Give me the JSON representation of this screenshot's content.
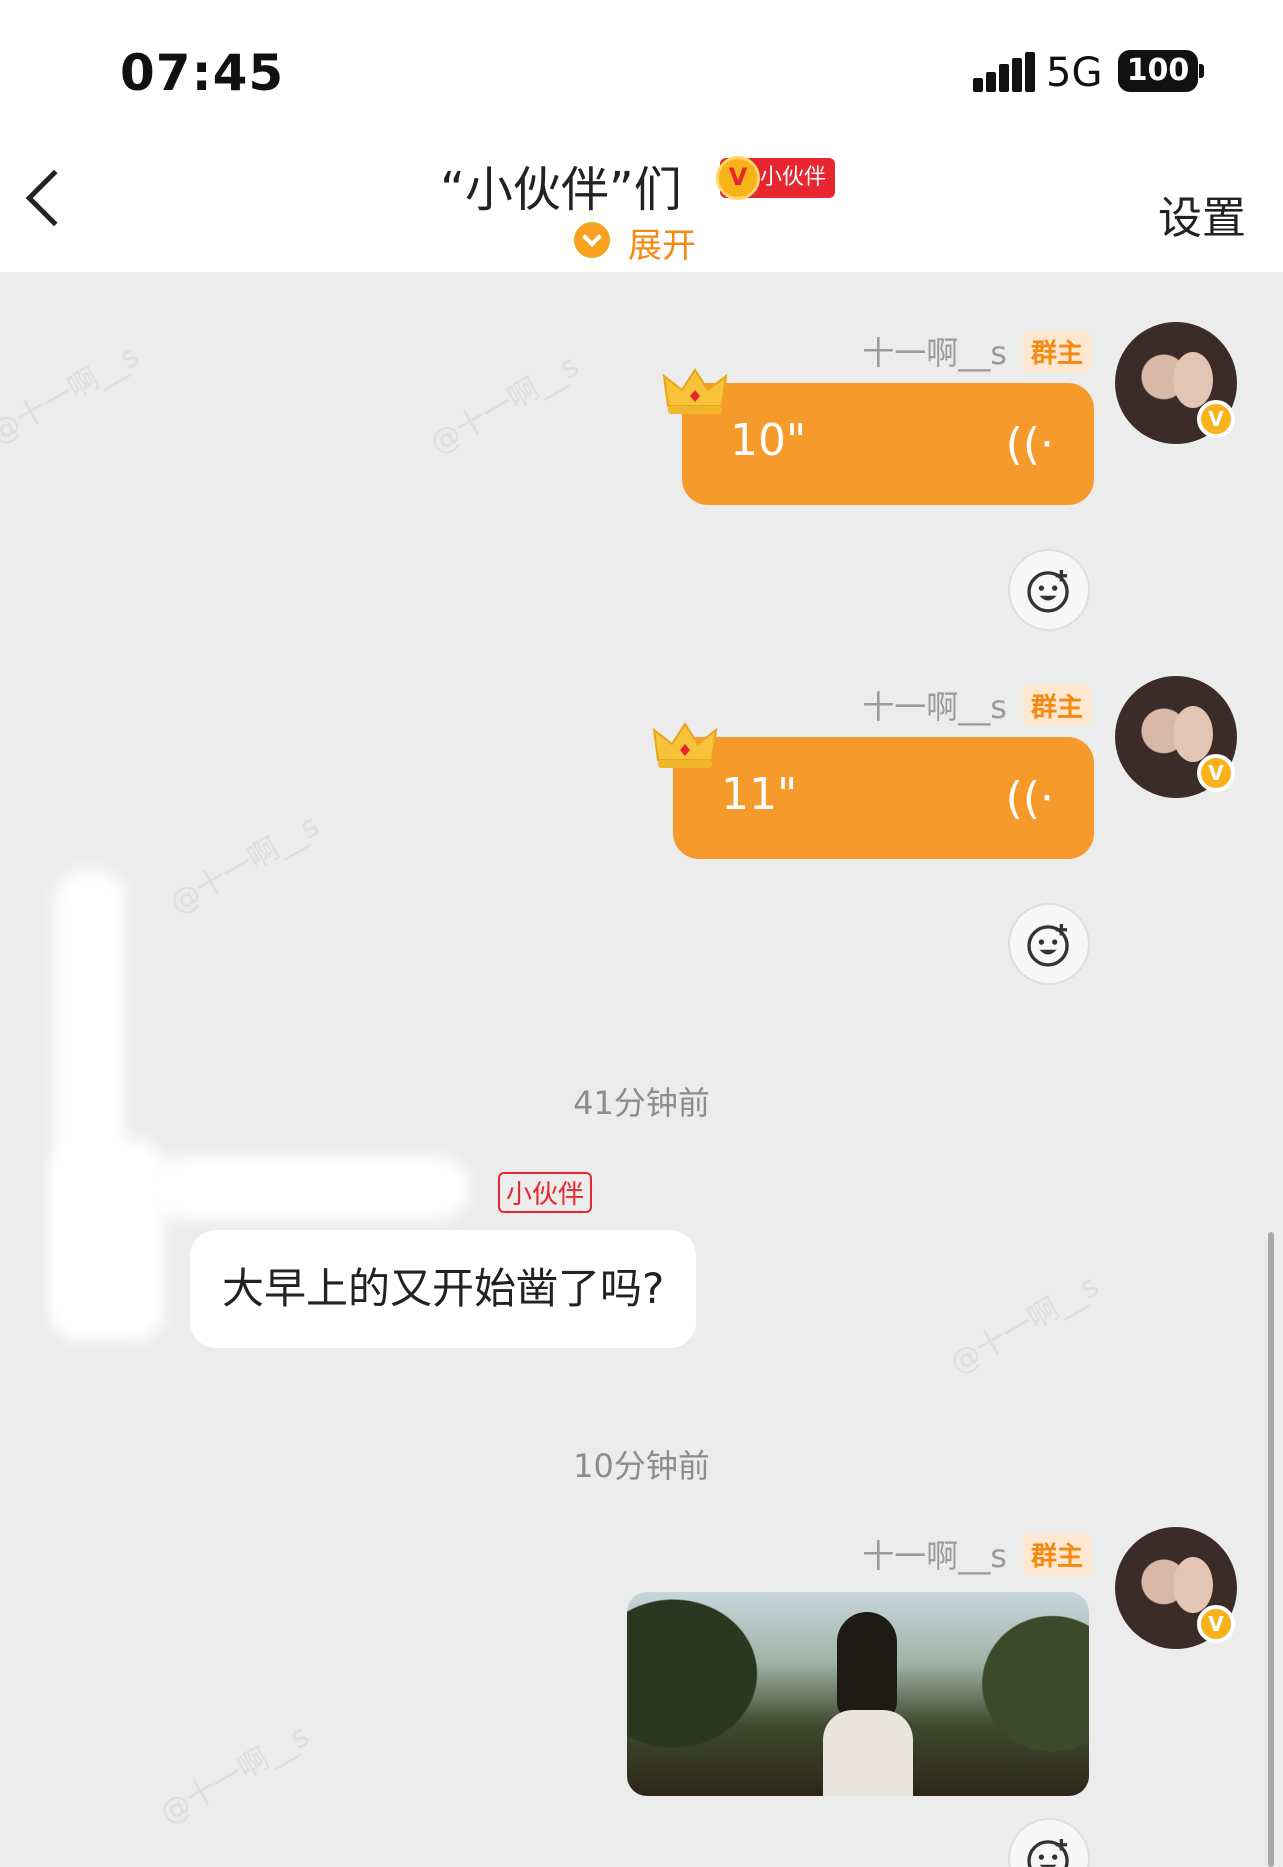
{
  "status_bar": {
    "time": "07:45",
    "network": "5G",
    "battery": "100"
  },
  "header": {
    "title": "“小伙伴”们",
    "title_badge_v": "V",
    "title_badge": "小伙伴",
    "expand_label": "展开",
    "settings_label": "设置"
  },
  "messages": [
    {
      "sender": "十一啊__s",
      "role_badge": "群主",
      "type": "voice",
      "duration": "10\"",
      "avatar_badge": "V"
    },
    {
      "sender": "十一啊__s",
      "role_badge": "群主",
      "type": "voice",
      "duration": "11\"",
      "avatar_badge": "V"
    },
    {
      "timestamp": "41分钟前"
    },
    {
      "sender_badge": "小伙伴",
      "type": "text",
      "text": "大早上的又开始凿了吗?"
    },
    {
      "timestamp": "10分钟前"
    },
    {
      "sender": "十一啊__s",
      "role_badge": "群主",
      "type": "image",
      "avatar_badge": "V"
    }
  ],
  "watermark_text": "@十一啊__s",
  "voice_icon": "((·",
  "colors": {
    "accent": "#f79a2c",
    "owner_badge": "#f58a13",
    "partner_red": "#e8262f",
    "background": "#ececec"
  }
}
